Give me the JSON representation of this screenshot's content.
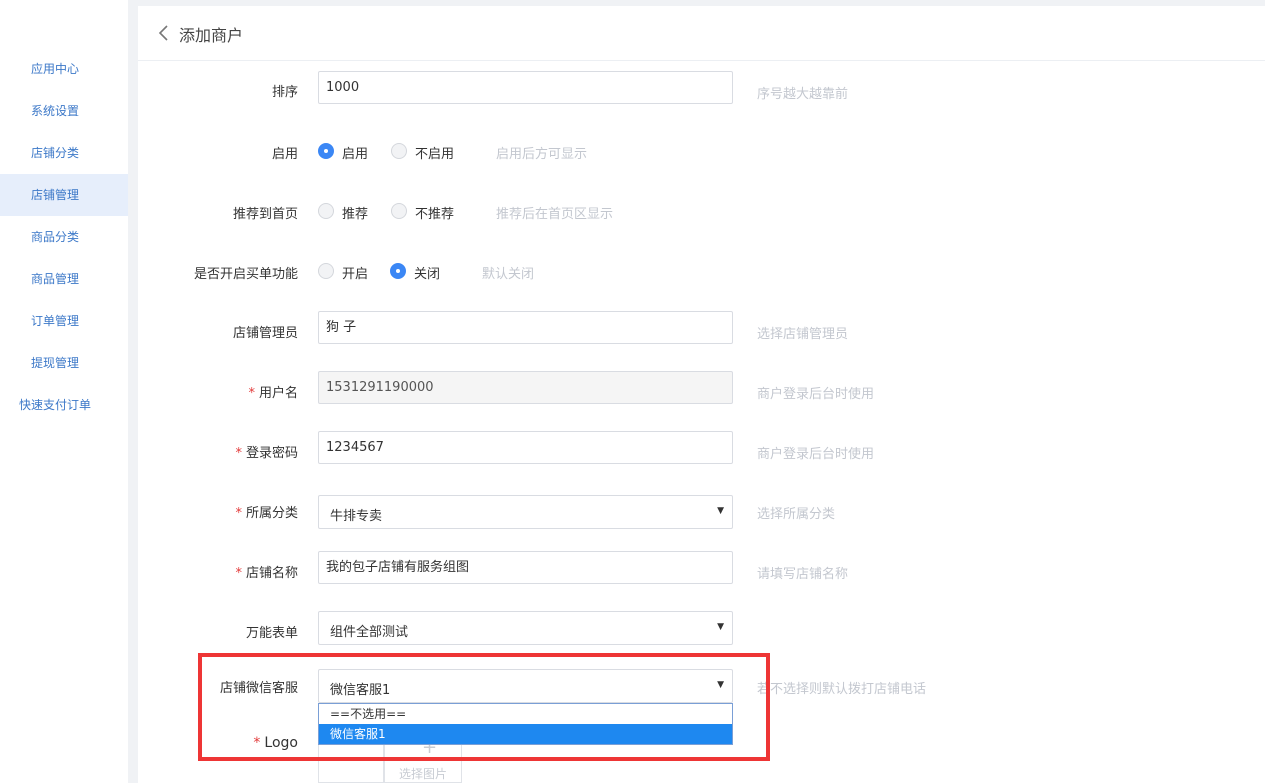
{
  "sidebar": {
    "items": [
      {
        "label": "应用中心"
      },
      {
        "label": "系统设置"
      },
      {
        "label": "店铺分类"
      },
      {
        "label": "店铺管理"
      },
      {
        "label": "商品分类"
      },
      {
        "label": "商品管理"
      },
      {
        "label": "订单管理"
      },
      {
        "label": "提现管理"
      },
      {
        "label": "快速支付订单"
      }
    ],
    "active_item": "店铺管理"
  },
  "header": {
    "back_icon": "chevron-left-icon",
    "title": "添加商户"
  },
  "form": {
    "sort": {
      "label": "排序",
      "value": "1000",
      "hint": "序号越大越靠前"
    },
    "enable": {
      "label": "启用",
      "options": [
        "启用",
        "不启用"
      ],
      "selected": "启用",
      "hint": "启用后方可显示"
    },
    "recommend": {
      "label": "推荐到首页",
      "options": [
        "推荐",
        "不推荐"
      ],
      "selected": "",
      "hint": "推荐后在首页区显示"
    },
    "buy_feature": {
      "label": "是否开启买单功能",
      "options": [
        "开启",
        "关闭"
      ],
      "selected": "关闭",
      "hint": "默认关闭"
    },
    "manager": {
      "label": "店铺管理员",
      "value": "狗 子",
      "hint": "选择店铺管理员"
    },
    "username": {
      "required": "*",
      "label": "用户名",
      "value": "1531291190000",
      "hint": "商户登录后台时使用"
    },
    "password": {
      "required": "*",
      "label": "登录密码",
      "value": "1234567",
      "hint": "商户登录后台时使用"
    },
    "category": {
      "required": "*",
      "label": "所属分类",
      "value": "牛排专卖",
      "hint": "选择所属分类"
    },
    "shop_name": {
      "required": "*",
      "label": "店铺名称",
      "value": "我的包子店铺有服务组图",
      "hint": "请填写店铺名称"
    },
    "universal_form": {
      "label": "万能表单",
      "value": "组件全部测试"
    },
    "wechat_service": {
      "label": "店铺微信客服",
      "value": "微信客服1",
      "hint": "若不选择则默认拨打店铺电话",
      "dropdown_options": [
        "==不选用==",
        "微信客服1"
      ],
      "dropdown_selected": "微信客服1"
    },
    "logo": {
      "required": "*",
      "label": "Logo",
      "upload_label": "选择图片"
    }
  },
  "colors": {
    "accent": "#3b87f5",
    "highlight": "#ee3535",
    "sidebar_text": "#3c78c8",
    "hint": "#c3c7cf"
  }
}
